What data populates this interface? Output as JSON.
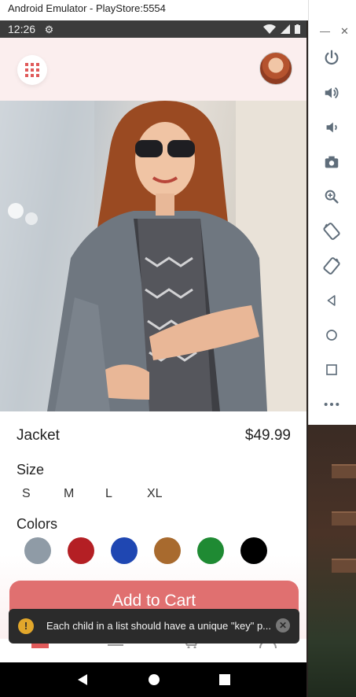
{
  "window": {
    "title": "Android Emulator - PlayStore:5554"
  },
  "status_bar": {
    "time": "12:26"
  },
  "product": {
    "name": "Jacket",
    "price": "$49.99"
  },
  "size": {
    "label": "Size",
    "options": [
      "S",
      "M",
      "L",
      "XL"
    ]
  },
  "colors": {
    "label": "Colors",
    "swatches": [
      "#8f9ba6",
      "#b41f24",
      "#1f47b2",
      "#a86a2e",
      "#1f8a33",
      "#000000"
    ]
  },
  "cart": {
    "button_label": "Add to Cart"
  },
  "toast": {
    "warning_symbol": "!",
    "message": "Each child in a list should have a unique \"key\" p..."
  },
  "emulator_controls": [
    "power-icon",
    "volume-up-icon",
    "volume-down-icon",
    "camera-icon",
    "zoom-icon",
    "rotate-left-icon",
    "rotate-right-icon",
    "back-icon",
    "home-icon",
    "overview-icon",
    "more-icon"
  ],
  "accent_color": "#e07070"
}
